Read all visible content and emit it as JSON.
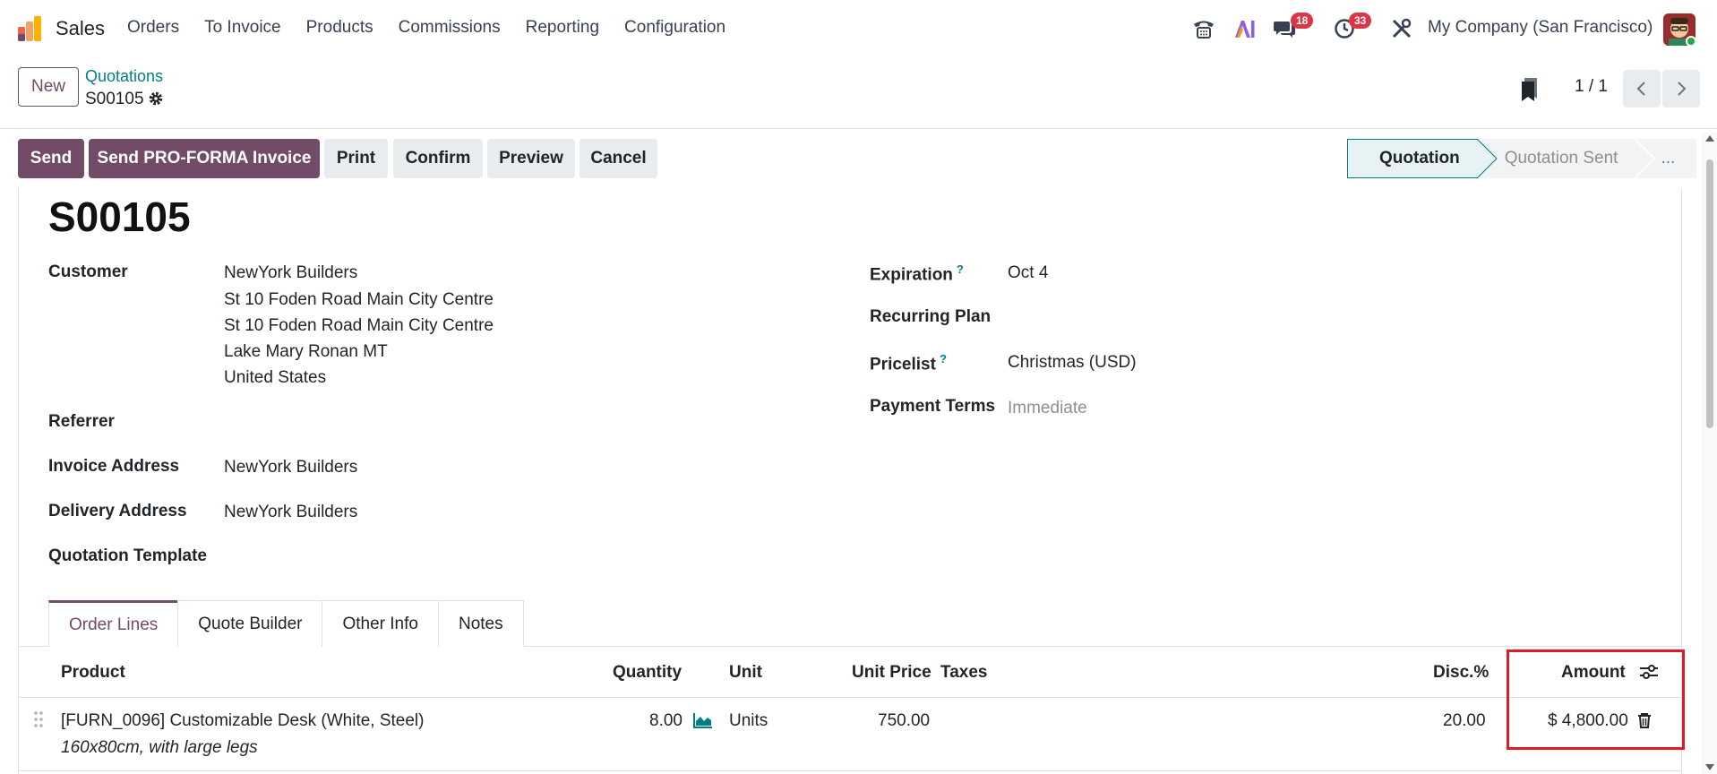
{
  "navbar": {
    "app_name": "Sales",
    "menu": [
      "Orders",
      "To Invoice",
      "Products",
      "Commissions",
      "Reporting",
      "Configuration"
    ],
    "messages_badge": "18",
    "activities_badge": "33",
    "company": "My Company (San Francisco)"
  },
  "control": {
    "new_label": "New",
    "breadcrumb_parent": "Quotations",
    "breadcrumb_current": "S00105",
    "pager": "1 / 1"
  },
  "actions": {
    "send": "Send",
    "proforma": "Send PRO-FORMA Invoice",
    "print": "Print",
    "confirm": "Confirm",
    "preview": "Preview",
    "cancel": "Cancel"
  },
  "status": {
    "stages": [
      "Quotation",
      "Quotation Sent",
      "..."
    ],
    "active": "Quotation"
  },
  "record": {
    "title": "S00105",
    "customer_label": "Customer",
    "customer_lines": [
      "NewYork Builders",
      "St 10 Foden Road Main City Centre",
      "St 10 Foden Road Main City Centre",
      "Lake Mary Ronan MT",
      "United States"
    ],
    "referrer_label": "Referrer",
    "invoice_address_label": "Invoice Address",
    "invoice_address": "NewYork Builders",
    "delivery_address_label": "Delivery Address",
    "delivery_address": "NewYork Builders",
    "quotation_template_label": "Quotation Template",
    "expiration_label": "Expiration",
    "expiration": "Oct 4",
    "recurring_plan_label": "Recurring Plan",
    "pricelist_label": "Pricelist",
    "pricelist": "Christmas (USD)",
    "payment_terms_label": "Payment Terms",
    "payment_terms_placeholder": "Immediate",
    "help_mark": "?"
  },
  "tabs": [
    "Order Lines",
    "Quote Builder",
    "Other Info",
    "Notes"
  ],
  "table": {
    "headers": {
      "product": "Product",
      "quantity": "Quantity",
      "unit": "Unit",
      "unit_price": "Unit Price",
      "taxes": "Taxes",
      "discount": "Disc.%",
      "amount": "Amount"
    },
    "rows": [
      {
        "product": "[FURN_0096] Customizable Desk (White, Steel)",
        "description": "160x80cm, with large legs",
        "quantity": "8.00",
        "unit": "Units",
        "unit_price": "750.00",
        "taxes": "",
        "discount": "20.00",
        "amount": "$ 4,800.00"
      }
    ]
  },
  "colors": {
    "brand": "#714b67",
    "accent": "#017e84",
    "badge": "#dc3545",
    "highlight": "#e01b24"
  }
}
